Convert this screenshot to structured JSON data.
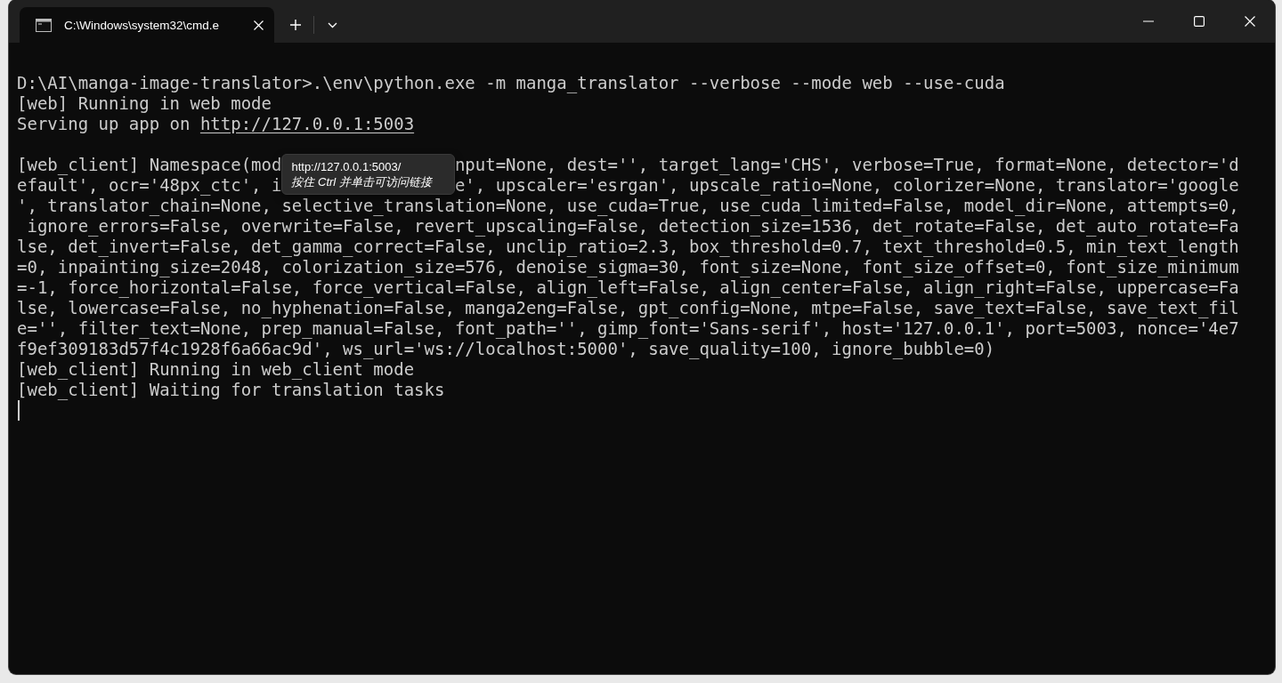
{
  "tabs": [
    {
      "title": "C:\\Windows\\system32\\cmd.e",
      "selected": true
    }
  ],
  "lines": [
    {
      "kind": "text",
      "text": "D:\\AI\\manga-image-translator>.\\env\\python.exe -m manga_translator --verbose --mode web --use-cuda"
    },
    {
      "kind": "text",
      "text": "[web] Running in web mode"
    },
    {
      "kind": "link",
      "text": "Serving up app on ",
      "link": "http://127.0.0.1:5003"
    },
    {
      "kind": "blank"
    },
    {
      "kind": "covered",
      "parts": [
        "[web_client] Namespace(mod",
        "nput=None, dest='', target_lang='CHS', verbose=True, format=None, detector='d"
      ]
    },
    {
      "kind": "covered",
      "parts": [
        "efault', ocr='48px_ctc', i",
        "e', upscaler='esrgan', upscale_ratio=None, colorizer=None, translator='google"
      ]
    },
    {
      "kind": "text",
      "text": "', translator_chain=None, selective_translation=None, use_cuda=True, use_cuda_limited=False, model_dir=None, attempts=0,"
    },
    {
      "kind": "text",
      "text": " ignore_errors=False, overwrite=False, revert_upscaling=False, detection_size=1536, det_rotate=False, det_auto_rotate=Fa"
    },
    {
      "kind": "text",
      "text": "lse, det_invert=False, det_gamma_correct=False, unclip_ratio=2.3, box_threshold=0.7, text_threshold=0.5, min_text_length"
    },
    {
      "kind": "text",
      "text": "=0, inpainting_size=2048, colorization_size=576, denoise_sigma=30, font_size=None, font_size_offset=0, font_size_minimum"
    },
    {
      "kind": "text",
      "text": "=-1, force_horizontal=False, force_vertical=False, align_left=False, align_center=False, align_right=False, uppercase=Fa"
    },
    {
      "kind": "text",
      "text": "lse, lowercase=False, no_hyphenation=False, manga2eng=False, gpt_config=None, mtpe=False, save_text=False, save_text_fil"
    },
    {
      "kind": "text",
      "text": "e='', filter_text=None, prep_manual=False, font_path='', gimp_font='Sans-serif', host='127.0.0.1', port=5003, nonce='4e7"
    },
    {
      "kind": "text",
      "text": "f9ef309183d57f4c1928f6a66ac9d', ws_url='ws://localhost:5000', save_quality=100, ignore_bubble=0)"
    },
    {
      "kind": "text",
      "text": "[web_client] Running in web_client mode"
    },
    {
      "kind": "text",
      "text": "[web_client] Waiting for translation tasks"
    }
  ],
  "tooltip": {
    "url": "http://127.0.0.1:5003/",
    "hint": "按住 Ctrl 并单击可访问链接"
  }
}
